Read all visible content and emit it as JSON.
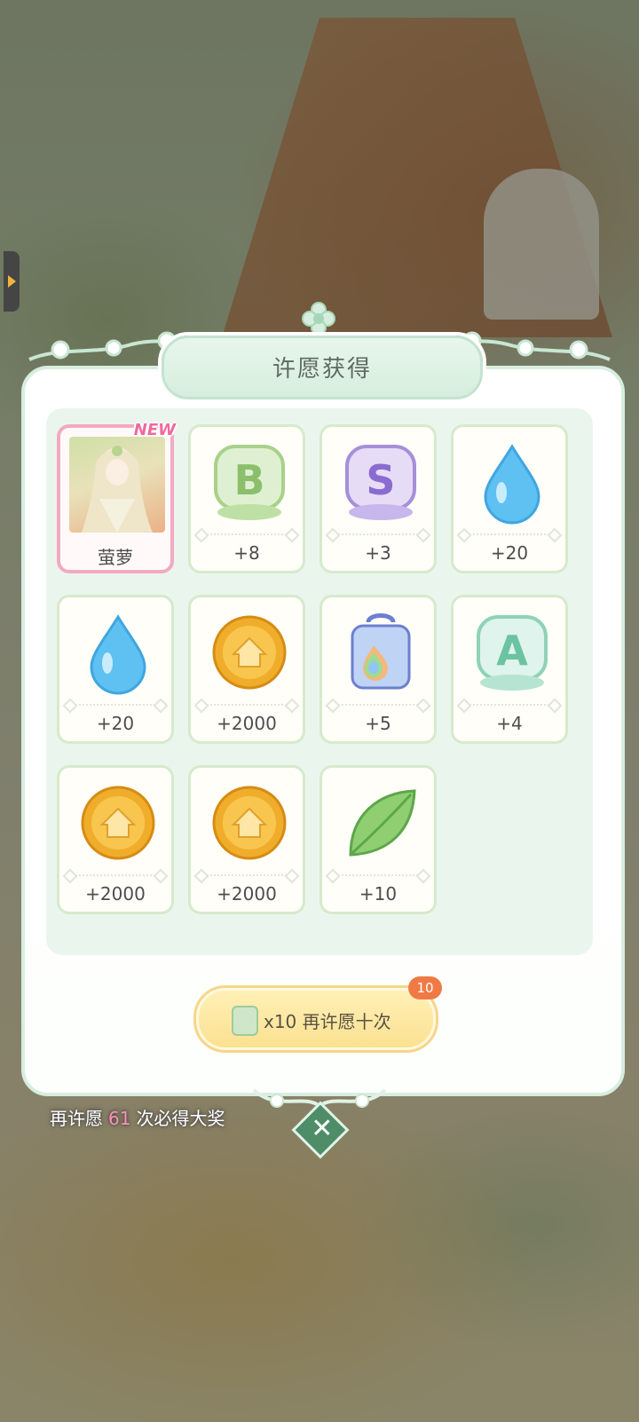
{
  "dialog": {
    "title": "许愿获得"
  },
  "rewards": [
    {
      "icon": "character-portrait-icon",
      "label": "萤萝",
      "badge": "NEW"
    },
    {
      "icon": "b-rank-emblem-icon",
      "label": "+8"
    },
    {
      "icon": "s-rank-emblem-icon",
      "label": "+3"
    },
    {
      "icon": "water-drop-icon",
      "label": "+20"
    },
    {
      "icon": "water-drop-icon",
      "label": "+20"
    },
    {
      "icon": "gold-coin-icon",
      "label": "+2000"
    },
    {
      "icon": "rainbow-canister-icon",
      "label": "+5"
    },
    {
      "icon": "a-rank-emblem-icon",
      "label": "+4"
    },
    {
      "icon": "gold-coin-icon",
      "label": "+2000"
    },
    {
      "icon": "gold-coin-icon",
      "label": "+2000"
    },
    {
      "icon": "leaf-icon",
      "label": "+10"
    }
  ],
  "again_button": {
    "label": "x10 再许愿十次",
    "badge": "10"
  },
  "pity": {
    "prefix": "再许愿",
    "count": "61",
    "suffix": "次必得大奖"
  },
  "colors": {
    "accent_green": "#4e8d67",
    "hero_border": "#f3a9c1",
    "badge_orange": "#f07a45"
  }
}
